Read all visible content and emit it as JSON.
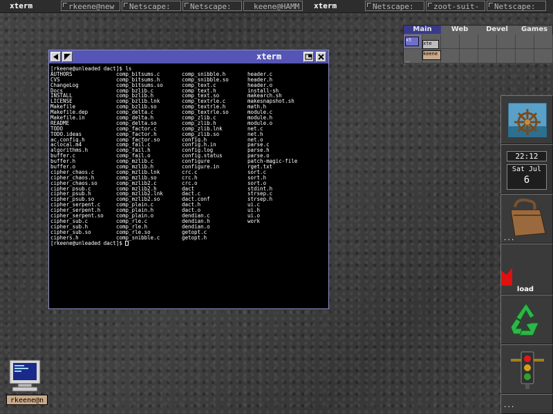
{
  "taskbar": {
    "tasks": [
      {
        "label": "xterm",
        "active": true
      },
      {
        "label": "rkeene@new",
        "active": false
      },
      {
        "label": "Netscape:",
        "active": false
      },
      {
        "label": "Netscape:",
        "active": false
      },
      {
        "label": "keene@HAMM",
        "active": false
      },
      {
        "label": "xterm",
        "active": true
      },
      {
        "label": "Netscape:",
        "active": false
      },
      {
        "label": "zoot-suit-",
        "active": false
      },
      {
        "label": "Netscape:",
        "active": false
      }
    ]
  },
  "pager": {
    "desktops": [
      "Main",
      "Web",
      "Devel",
      "Games"
    ],
    "current": "Main",
    "mini_windows": {
      "xterm1": "xt",
      "xterm2": "xte",
      "keene": "keene"
    }
  },
  "xterm": {
    "title": "xterm",
    "prompt_cmd": "[rkeene@unleaded dact]$ ls",
    "final_prompt": "[rkeene@unleaded dact]$ ",
    "ls_columns": [
      [
        "AUTHORS",
        "CVS",
        "ChangeLog",
        "Docs",
        "INSTALL",
        "LICENSE",
        "Makefile",
        "Makefile.dep",
        "Makefile.in",
        "README",
        "TODO",
        "TODO.ideas",
        "ac.config.h",
        "aclocal.m4",
        "algorithms.h",
        "buffer.c",
        "buffer.h",
        "buffer.o",
        "cipher_chaos.c",
        "cipher_chaos.h",
        "cipher_chaos.so",
        "cipher_psub.c",
        "cipher_psub.h",
        "cipher_psub.so",
        "cipher_serpent.c",
        "cipher_serpent.h",
        "cipher_serpent.so",
        "cipher_sub.c",
        "cipher_sub.h",
        "cipher_sub.so",
        "ciphers.h"
      ],
      [
        "comp_bitsums.c",
        "comp_bitsums.h",
        "comp_bitsums.so",
        "comp_bzlib.c",
        "comp_bzlib.h",
        "comp_bzlib.lnk",
        "comp_bzlib.so",
        "comp_delta.c",
        "comp_delta.h",
        "comp_delta.so",
        "comp_factor.c",
        "comp_factor.h",
        "comp_factor.so",
        "comp_fail.c",
        "comp_fail.h",
        "comp_fail.o",
        "comp_mzlib.c",
        "comp_mzlib.h",
        "comp_mzlib.lnk",
        "comp_mzlib.so",
        "comp_mzlib2.c",
        "comp_mzlib2.h",
        "comp_mzlib2.lnk",
        "comp_mzlib2.so",
        "comp_plain.c",
        "comp_plain.h",
        "comp_plain.o",
        "comp_rle.c",
        "comp_rle.h",
        "comp_rle.so",
        "comp_snibble.c"
      ],
      [
        "comp_snibble.h",
        "comp_snibble.so",
        "comp_text.c",
        "comp_text.h",
        "comp_text.so",
        "comp_textrle.c",
        "comp_textrle.h",
        "comp_textrle.so",
        "comp_zlib.c",
        "comp_zlib.h",
        "comp_zlib.lnk",
        "comp_zlib.so",
        "config.h",
        "config.h.in",
        "config.log",
        "config.status",
        "configure",
        "configure.in",
        "crc.c",
        "crc.h",
        "crc.o",
        "dact",
        "dact.c",
        "dact.conf",
        "dact.h",
        "dact.o",
        "dendian.c",
        "dendian.h",
        "dendian.o",
        "getopt.c",
        "getopt.h"
      ],
      [
        "header.c",
        "header.h",
        "header.o",
        "install-sh",
        "makearch.sh",
        "makesnapshot.sh",
        "math.h",
        "module.c",
        "module.h",
        "module.o",
        "net.c",
        "net.h",
        "net.o",
        "parse.c",
        "parse.h",
        "parse.o",
        "patch-magic-file",
        "rget.txt",
        "sort.c",
        "sort.h",
        "sort.o",
        "stdint.h",
        "strsep.c",
        "strsep.h",
        "ui.c",
        "ui.h",
        "ui.o",
        "work"
      ]
    ]
  },
  "dock": {
    "clock": {
      "time": "22:12",
      "date": "Sat Jul",
      "day": "6"
    },
    "load_label": "load",
    "ellipsis": "..."
  },
  "desktop_icon": {
    "label": "rkeene@n"
  }
}
